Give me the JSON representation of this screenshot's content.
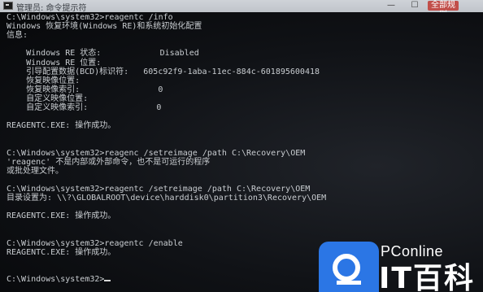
{
  "window": {
    "title": "管理员: 命令提示符",
    "minimize_glyph": "—",
    "maximize_glyph": "☐",
    "close_label": "全部规则"
  },
  "console": {
    "lines": [
      "C:\\Windows\\system32>reagentc /info",
      "Windows 恢复环境(Windows RE)和系统初始化配置",
      "信息:",
      "",
      "    Windows RE 状态:            Disabled",
      "    Windows RE 位置:",
      "    引导配置数据(BCD)标识符:   605c92f9-1aba-11ec-884c-601895600418",
      "    恢复映像位置:",
      "    恢复映像索引:                0",
      "    自定义映像位置:",
      "    自定义映像索引:              0",
      "",
      "REAGENTC.EXE: 操作成功。",
      "",
      "",
      "C:\\Windows\\system32>reagenc /setreimage /path C:\\Recovery\\OEM",
      "'reagenc' 不是内部或外部命令，也不是可运行的程序",
      "或批处理文件。",
      "",
      "C:\\Windows\\system32>reagentc /setreimage /path C:\\Recovery\\OEM",
      "目录设置为: \\\\?\\GLOBALROOT\\device\\harddisk0\\partition3\\Recovery\\OEM",
      "",
      "REAGENTC.EXE: 操作成功。",
      "",
      "",
      "C:\\Windows\\system32>reagentc /enable",
      "REAGENTC.EXE: 操作成功。",
      "",
      "",
      "C:\\Windows\\system32>"
    ]
  },
  "watermark": {
    "brand_small": "PConline",
    "brand_big": "IT百科",
    "accent_color": "#2b76e5"
  },
  "icons": {
    "title_icon": "cmd-icon",
    "logo_icon": "pconline-logo-icon"
  }
}
